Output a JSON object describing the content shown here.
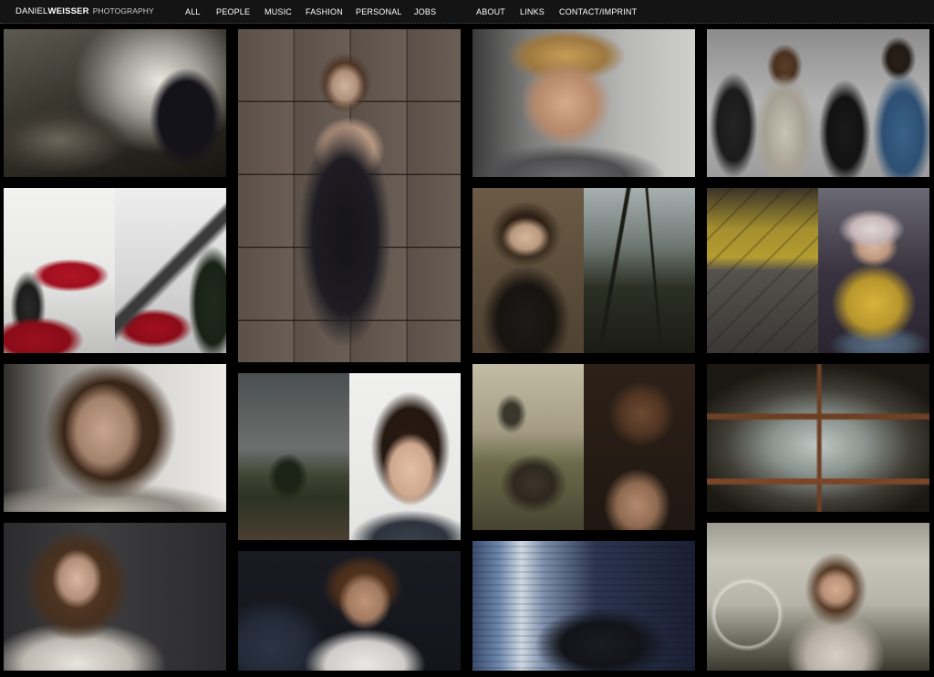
{
  "header": {
    "logo_first": "DANIEL",
    "logo_last": "WEISSER",
    "logo_tag": "PHOTOGRAPHY"
  },
  "nav": {
    "all": "ALL",
    "people": "PEOPLE",
    "music": "MUSIC",
    "fashion": "FASHION",
    "personal": "PERSONAL",
    "jobs": "JOBS",
    "about": "ABOUT",
    "links": "LINKS",
    "contact": "CONTACT/IMPRINT"
  },
  "colors": {
    "background": "#000000",
    "topbar": "#141414",
    "nav_text": "#ffffff"
  }
}
